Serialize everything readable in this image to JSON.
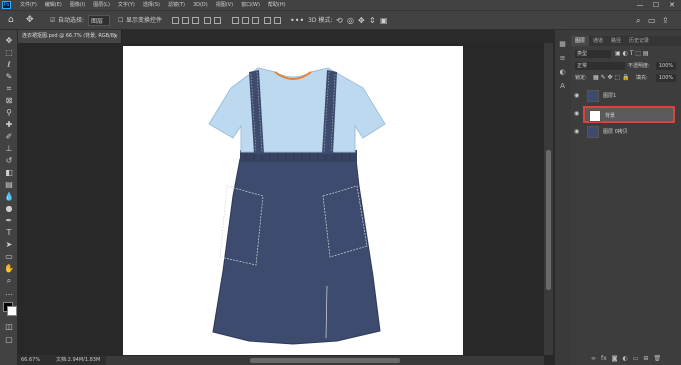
{
  "app": {
    "logo": "Ps"
  },
  "menubar": {
    "items": [
      "文件(F)",
      "编辑(E)",
      "图像(I)",
      "图层(L)",
      "文字(Y)",
      "选择(S)",
      "滤镜(T)",
      "3D(D)",
      "视图(V)",
      "窗口(W)",
      "帮助(H)"
    ]
  },
  "window_controls": {
    "minimize": "—",
    "maximize": "☐",
    "close": "✕"
  },
  "options": {
    "auto_select_label": "自动选择:",
    "auto_select_value": "图层",
    "transform_label": "显示变换控件",
    "mode3d_label": "3D 模式:"
  },
  "tab": {
    "title": "连衣裙抠图.psd @ 66.7% (背景, RGB/8)",
    "close": "×"
  },
  "status": {
    "zoom": "66.67%",
    "doc": "文档:2.94M/1.83M"
  },
  "panel": {
    "tabs": [
      "图层",
      "通道",
      "路径",
      "历史记录"
    ],
    "filter_label": "类型",
    "blend_mode": "正常",
    "opacity_label": "不透明度:",
    "opacity_value": "100%",
    "lock_label": "锁定:",
    "fill_label": "填充:",
    "fill_value": "100%",
    "layers": [
      {
        "name": "图层1"
      },
      {
        "name": "背景"
      },
      {
        "name": "图层 0拷贝"
      }
    ]
  }
}
